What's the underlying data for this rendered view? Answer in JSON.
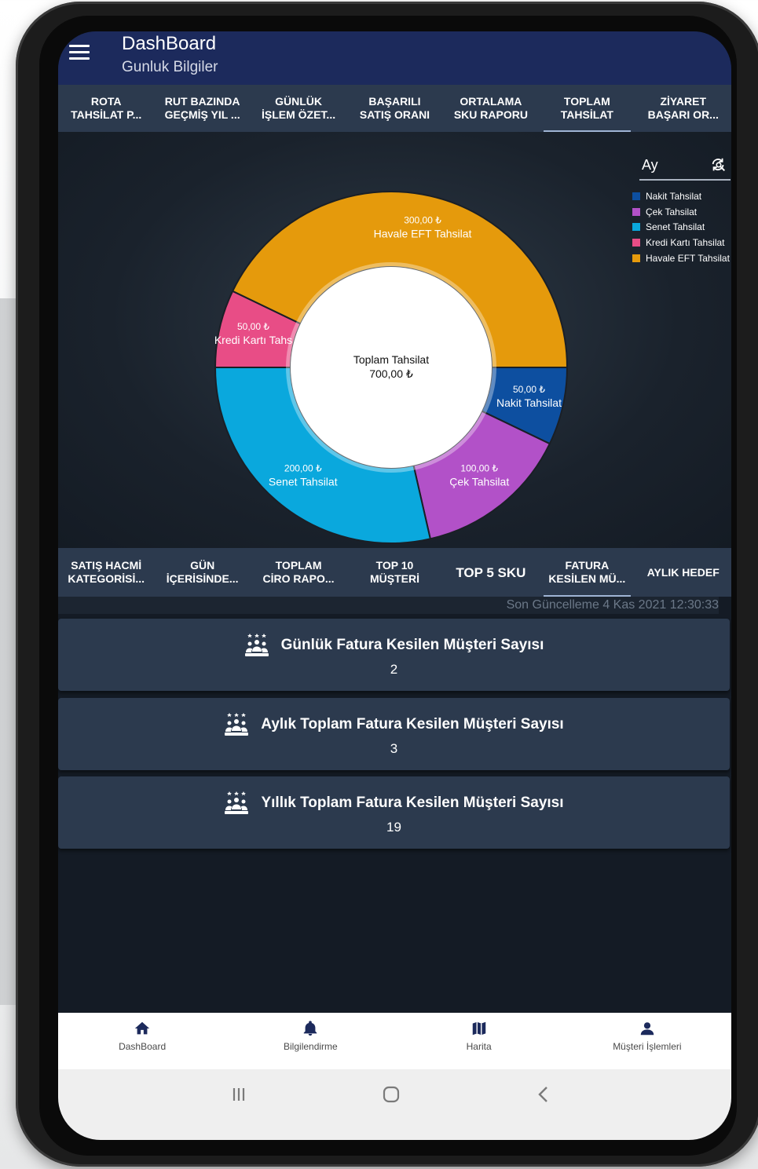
{
  "appbar": {
    "title": "DashBoard",
    "subtitle": "Gunluk Bilgiler"
  },
  "top_tabs": [
    "ROTA\nTAHSİLAT P...",
    "RUT BAZINDA\nGEÇMİŞ YIL ...",
    "GÜNLÜK\nİŞLEM ÖZET...",
    "BAŞARILI\nSATIŞ ORANI",
    "ORTALAMA\nSKU RAPORU",
    "TOPLAM\nTAHSİLAT",
    "ZİYARET\nBAŞARI OR..."
  ],
  "active_top_tab": "TOPLAM\nTAHSİLAT",
  "period_select": {
    "value": "Ay"
  },
  "chart_data": {
    "type": "pie",
    "donut": true,
    "center_label": "Toplam Tahsilat",
    "center_value": "700,00 ₺",
    "total": 700,
    "slices": [
      {
        "name": "Nakit Tahsilat",
        "value": 50,
        "label": "50,00 ₺",
        "color": "#0d4fa0"
      },
      {
        "name": "Çek Tahsilat",
        "value": 100,
        "label": "100,00 ₺",
        "color": "#b251c8"
      },
      {
        "name": "Senet Tahsilat",
        "value": 200,
        "label": "200,00 ₺",
        "color": "#0aa8dd"
      },
      {
        "name": "Kredi Kartı Tahsilat",
        "value": 50,
        "label": "50,00 ₺",
        "color": "#e84d86",
        "display_name": "Kredi Kartı Tahs"
      },
      {
        "name": "Havale EFT Tahsilat",
        "value": 300,
        "label": "300,00 ₺",
        "color": "#e59a0c"
      }
    ],
    "legend": [
      "Nakit Tahsilat",
      "Çek Tahsilat",
      "Senet Tahsilat",
      "Kredi Kartı Tahsilat",
      "Havale EFT Tahsilat"
    ],
    "legend_position": "top-right"
  },
  "mid_tabs": [
    "SATIŞ HACMİ\nKATEGORİSİ...",
    "GÜN\nİÇERİSİNDE...",
    "TOPLAM\nCİRO RAPO...",
    "TOP 10\nMÜŞTERİ",
    "TOP 5 SKU",
    "FATURA\nKESİLEN MÜ...",
    "AYLIK HEDEF"
  ],
  "active_mid_tab": "FATURA\nKESİLEN MÜ...",
  "last_update": "Son Güncelleme 4 Kas 2021 12:30:33",
  "cards": [
    {
      "title": "Günlük Fatura Kesilen Müşteri Sayısı",
      "value": "2",
      "icon": "customers-icon"
    },
    {
      "title": "Aylık Toplam Fatura Kesilen Müşteri Sayısı",
      "value": "3",
      "icon": "customers-icon"
    },
    {
      "title": "Yıllık Toplam Fatura Kesilen Müşteri Sayısı",
      "value": "19",
      "icon": "customers-icon"
    }
  ],
  "bottom_nav": [
    {
      "label": "DashBoard",
      "icon": "home-icon"
    },
    {
      "label": "Bilgilendirme",
      "icon": "bell-icon"
    },
    {
      "label": "Harita",
      "icon": "map-icon"
    },
    {
      "label": "Müşteri İşlemleri",
      "icon": "person-icon"
    }
  ],
  "system_nav": [
    "recents-button",
    "home-button",
    "back-button"
  ]
}
